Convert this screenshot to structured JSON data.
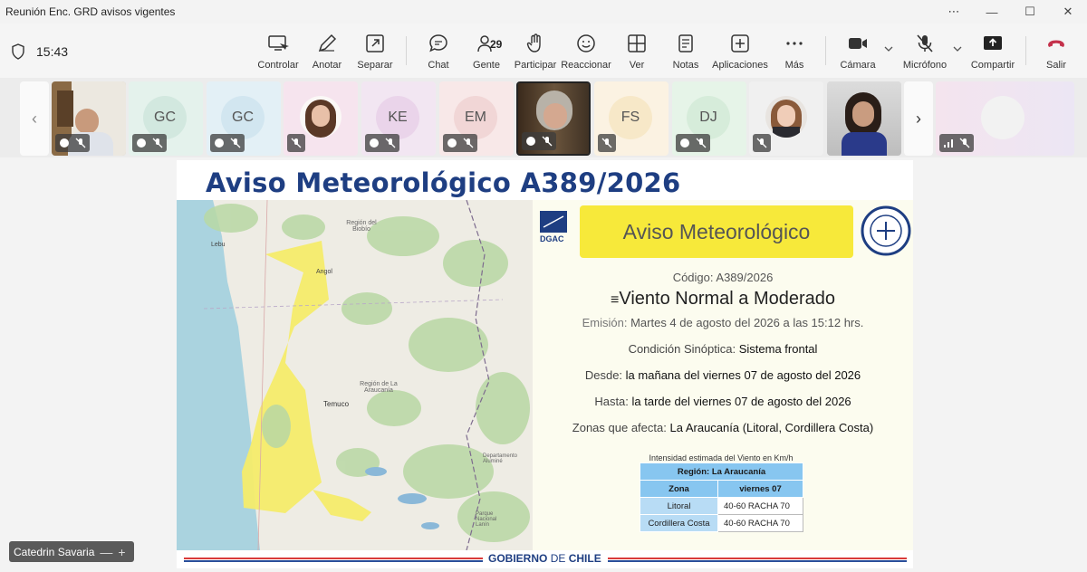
{
  "window": {
    "title": "Reunión Enc. GRD avisos vigentes",
    "controls": [
      "⋯",
      "—",
      "☐",
      "✕"
    ]
  },
  "toolbar": {
    "timer": "15:43",
    "buttons": [
      {
        "id": "controlar",
        "label": "Controlar"
      },
      {
        "id": "anotar",
        "label": "Anotar"
      },
      {
        "id": "separar",
        "label": "Separar"
      },
      {
        "id": "chat",
        "label": "Chat"
      },
      {
        "id": "gente",
        "label": "Gente",
        "count": "29"
      },
      {
        "id": "participar",
        "label": "Participar"
      },
      {
        "id": "reaccionar",
        "label": "Reaccionar"
      },
      {
        "id": "ver",
        "label": "Ver"
      },
      {
        "id": "notas",
        "label": "Notas"
      },
      {
        "id": "aplicaciones",
        "label": "Aplicaciones"
      },
      {
        "id": "mas",
        "label": "Más"
      },
      {
        "id": "camara",
        "label": "Cámara"
      },
      {
        "id": "microfono",
        "label": "Micrófono"
      },
      {
        "id": "compartir",
        "label": "Compartir"
      },
      {
        "id": "salir",
        "label": "Salir"
      }
    ],
    "leave_color": "#c4314b"
  },
  "participants": [
    {
      "initials": "",
      "kind": "video"
    },
    {
      "initials": "GC",
      "kind": "initials",
      "color": "#d9ece6"
    },
    {
      "initials": "GC",
      "kind": "initials",
      "color": "#d7e9f1"
    },
    {
      "initials": "",
      "kind": "photo"
    },
    {
      "initials": "KE",
      "kind": "initials",
      "color": "#ead8ea"
    },
    {
      "initials": "EM",
      "kind": "initials",
      "color": "#f1dcdc"
    },
    {
      "initials": "",
      "kind": "video"
    },
    {
      "initials": "FS",
      "kind": "initials",
      "color": "#f7ecd5"
    },
    {
      "initials": "DJ",
      "kind": "initials",
      "color": "#dcefe0"
    },
    {
      "initials": "",
      "kind": "photo"
    },
    {
      "initials": "",
      "kind": "video"
    },
    {
      "initials": "",
      "kind": "overflow"
    }
  ],
  "share": {
    "heading": "Aviso Meteorológico A389/2026",
    "map_labels": {
      "region_biobio": "Región del Biobío",
      "lebu": "Lebu",
      "angol": "Angol",
      "region_araucania": "Región de La Araucanía",
      "temuco": "Temuco",
      "departamento": "Departamento Aluminé",
      "parque": "Parque Nacional Lanín"
    },
    "panel": {
      "title": "Aviso Meteorológico",
      "logo_text": "DGAC",
      "codigo_label": "Código:",
      "codigo_value": "A389/2026",
      "evento": "Viento Normal a Moderado",
      "emision_label": "Emisión:",
      "emision_value": "Martes 4 de agosto del 2026 a las 15:12 hrs.",
      "condicion_label": "Condición Sinóptica:",
      "condicion_value": "Sistema frontal",
      "desde_label": "Desde:",
      "desde_value": "la mañana del viernes 07 de agosto del 2026",
      "hasta_label": "Hasta:",
      "hasta_value": "la tarde del viernes 07 de agosto del 2026",
      "zonas_label": "Zonas que afecta:",
      "zonas_value": "La Araucanía (Litoral, Cordillera Costa)",
      "table_caption": "Intensidad estimada del Viento en Km/h",
      "table": {
        "region": "Región: La Araucanía",
        "col_zona": "Zona",
        "col_dia": "viernes 07",
        "rows": [
          {
            "zona": "Litoral",
            "valor": "40-60 RACHA 70"
          },
          {
            "zona": "Cordillera Costa",
            "valor": "40-60 RACHA 70"
          }
        ]
      }
    },
    "footer": {
      "gob": "GOBIERNO",
      "de": "DE",
      "chile": "CHILE"
    }
  },
  "presenter": {
    "name": "Catedrin Savaria",
    "min": "—",
    "plus": "+"
  }
}
